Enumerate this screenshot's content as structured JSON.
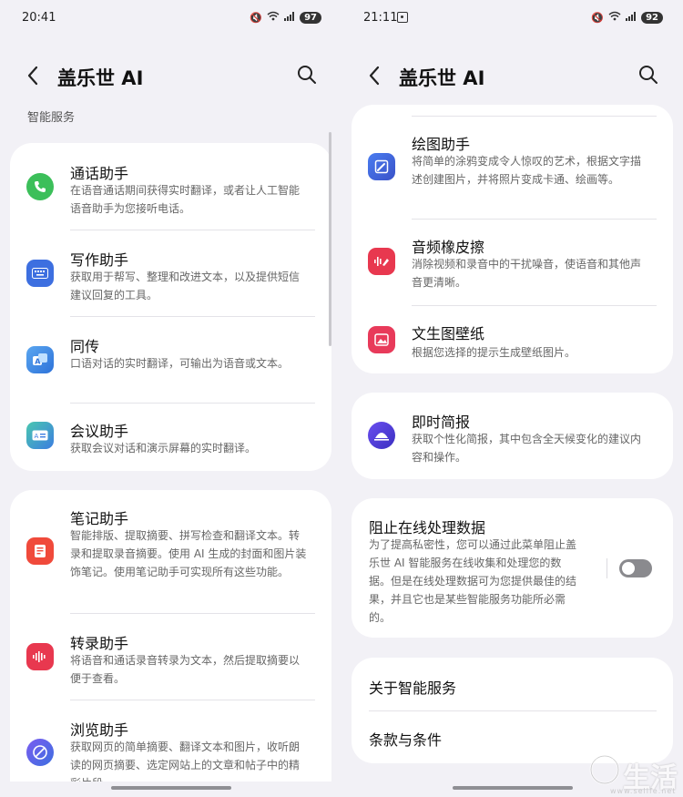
{
  "left": {
    "status": {
      "time": "20:41",
      "battery": "97"
    },
    "title": "盖乐世 AI",
    "section_label": "智能服务",
    "card1": [
      {
        "name": "通话助手",
        "desc": "在语音通话期间获得实时翻译，或者让人工智能语音助手为您接听电话。",
        "icon": "phone-icon"
      },
      {
        "name": "写作助手",
        "desc": "获取用于帮写、整理和改进文本，以及提供短信建议回复的工具。",
        "icon": "keyboard-icon"
      },
      {
        "name": "同传",
        "desc": "口语对话的实时翻译，可输出为语音或文本。",
        "icon": "translate-icon"
      },
      {
        "name": "会议助手",
        "desc": "获取会议对话和演示屏幕的实时翻译。",
        "icon": "meeting-icon"
      }
    ],
    "card2": [
      {
        "name": "笔记助手",
        "desc": "智能排版、提取摘要、拼写检查和翻译文本。转录和提取录音摘要。使用 AI 生成的封面和图片装饰笔记。使用笔记助手可实现所有这些功能。",
        "icon": "notes-icon"
      },
      {
        "name": "转录助手",
        "desc": "将语音和通话录音转录为文本，然后提取摘要以便于查看。",
        "icon": "transcript-icon"
      },
      {
        "name": "浏览助手",
        "desc": "获取网页的简单摘要、翻译文本和图片，收听朗读的网页摘要、选定网站上的文章和帖子中的精彩片段",
        "icon": "browser-icon"
      }
    ]
  },
  "right": {
    "status": {
      "time": "21:11",
      "battery": "92"
    },
    "title": "盖乐世 AI",
    "card1": [
      {
        "name": "绘图助手",
        "desc": "将简单的涂鸦变成令人惊叹的艺术，根据文字描述创建图片，并将照片变成卡通、绘画等。",
        "icon": "sketch-icon"
      },
      {
        "name": "音频橡皮擦",
        "desc": "消除视频和录音中的干扰噪音，使语音和其他声音更清晰。",
        "icon": "audio-eraser-icon"
      },
      {
        "name": "文生图壁纸",
        "desc": "根据您选择的提示生成壁纸图片。",
        "icon": "wallpaper-icon"
      }
    ],
    "card2": [
      {
        "name": "即时简报",
        "desc": "获取个性化简报，其中包含全天候变化的建议内容和操作。",
        "icon": "briefing-icon"
      }
    ],
    "privacy": {
      "name": "阻止在线处理数据",
      "desc": "为了提高私密性，您可以通过此菜单阻止盖乐世 AI 智能服务在线收集和处理您的数据。但是在线处理数据可为您提供最佳的结果，并且它也是某些智能服务功能所必需的。",
      "toggle": "off"
    },
    "links": [
      "关于智能服务",
      "条款与条件"
    ]
  },
  "watermark": {
    "text": "生活",
    "url": "www.sellfe.net"
  }
}
